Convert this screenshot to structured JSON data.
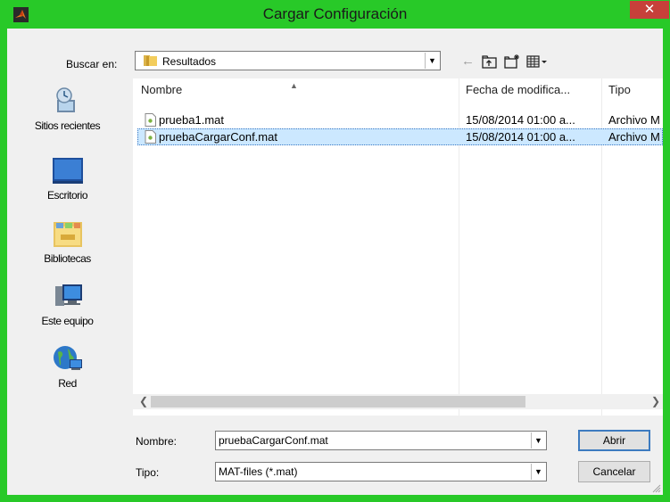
{
  "window": {
    "title": "Cargar Configuración",
    "close_symbol": "✕",
    "accent_color": "#28c928",
    "app_icon": "matlab-icon"
  },
  "lookin": {
    "label": "Buscar en:",
    "value": "Resultados",
    "toolbar_icons": [
      "back-arrow-icon",
      "up-folder-icon",
      "new-folder-icon",
      "view-menu-icon"
    ]
  },
  "places": [
    {
      "label": "Sitios recientes",
      "icon": "recent-places-icon"
    },
    {
      "label": "Escritorio",
      "icon": "desktop-icon"
    },
    {
      "label": "Bibliotecas",
      "icon": "libraries-icon"
    },
    {
      "label": "Este equipo",
      "icon": "computer-icon"
    },
    {
      "label": "Red",
      "icon": "network-icon"
    }
  ],
  "files": {
    "columns": [
      "Nombre",
      "Fecha de modifica...",
      "Tipo"
    ],
    "sorted_column": "Nombre",
    "rows": [
      {
        "name": "prueba1.mat",
        "date": "15/08/2014 01:00 a...",
        "type": "Archivo M",
        "selected": false
      },
      {
        "name": "pruebaCargarConf.mat",
        "date": "15/08/2014 01:00 a...",
        "type": "Archivo M",
        "selected": true
      }
    ]
  },
  "form": {
    "name_label": "Nombre:",
    "name_value": "pruebaCargarConf.mat",
    "type_label": "Tipo:",
    "type_value": "MAT-files (*.mat)",
    "open_button": "Abrir",
    "cancel_button": "Cancelar"
  }
}
